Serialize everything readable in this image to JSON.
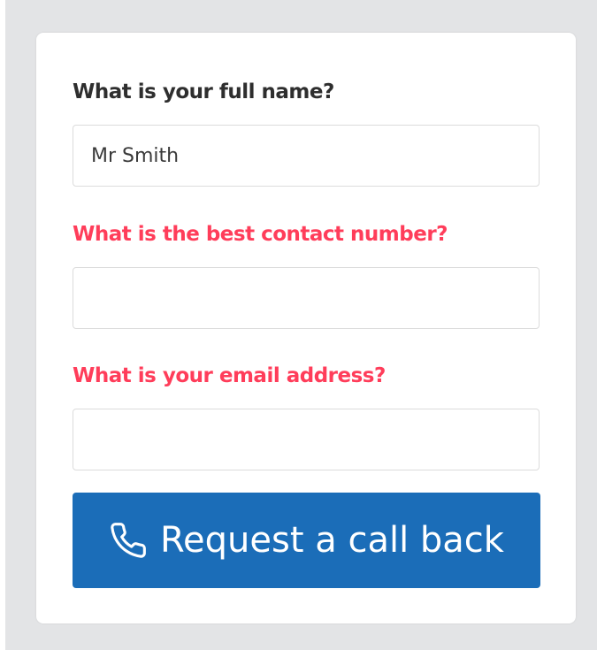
{
  "form": {
    "colors": {
      "label_default": "#2e2e2e",
      "label_error": "#ff3d5a",
      "button_bg": "#1b6db8"
    },
    "fields": [
      {
        "label": "What is your full name?",
        "value": "Mr Smith",
        "state": "valid"
      },
      {
        "label": "What is the best contact number?",
        "value": "",
        "state": "error"
      },
      {
        "label": "What is your email address?",
        "value": "",
        "state": "error"
      }
    ],
    "submit": {
      "label": "Request a call back",
      "icon": "phone-icon"
    }
  }
}
